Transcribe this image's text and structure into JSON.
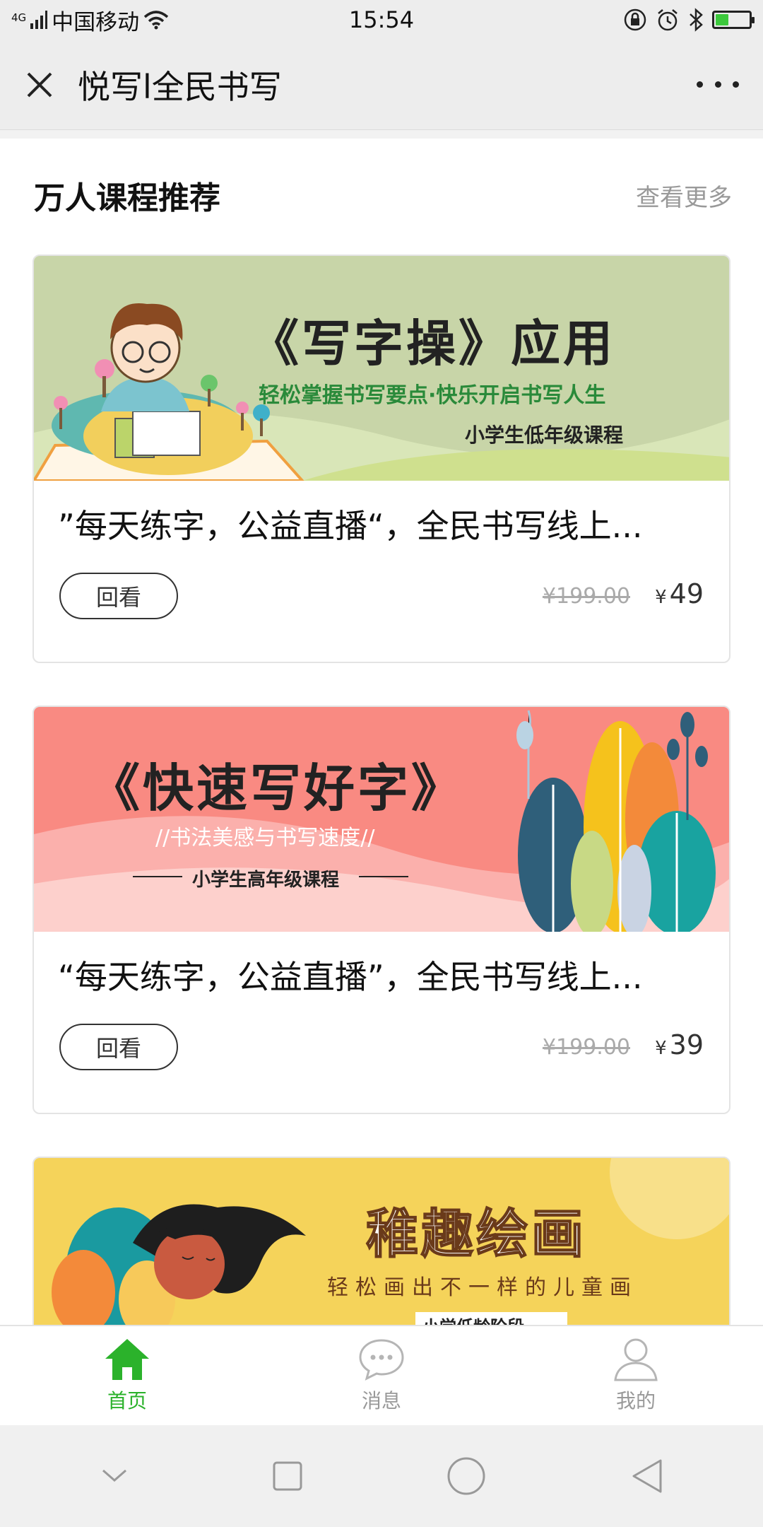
{
  "status_bar": {
    "network": "4G",
    "carrier": "中国移动",
    "time": "15:54"
  },
  "navbar": {
    "title": "悦写l全民书写"
  },
  "section": {
    "title": "万人课程推荐",
    "more_label": "查看更多"
  },
  "courses": [
    {
      "banner_title": "《写字操》应用",
      "banner_subtitle": "轻松掌握书写要点·快乐开启书写人生",
      "banner_tag": "小学生低年级课程",
      "title": "”每天练字，公益直播“，全民书写线上...",
      "button_label": "回看",
      "original_price": "¥199.00",
      "currency": "¥",
      "price": "49"
    },
    {
      "banner_title": "《快速写好字》",
      "banner_subtitle": "//书法美感与书写速度//",
      "banner_tag": "小学生高年级课程",
      "title": "“每天练字，公益直播”，全民书写线上...",
      "button_label": "回看",
      "original_price": "¥199.00",
      "currency": "¥",
      "price": "39"
    },
    {
      "banner_title": "稚趣绘画",
      "banner_subtitle": "轻松画出不一样的儿童画",
      "banner_tag": "小学低龄阶段"
    }
  ],
  "tabbar": {
    "items": [
      {
        "label": "首页",
        "icon": "home-icon"
      },
      {
        "label": "消息",
        "icon": "message-icon"
      },
      {
        "label": "我的",
        "icon": "profile-icon"
      }
    ]
  },
  "colors": {
    "accent": "#2bb22b",
    "banner1_bg": "#c8d5a8",
    "banner2_bg": "#f98a82",
    "banner3_bg": "#f5d35a"
  }
}
